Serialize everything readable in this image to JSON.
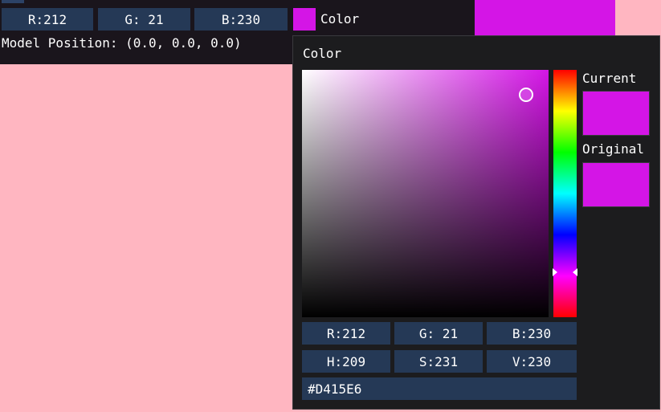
{
  "main_window": {
    "rgb_fields": {
      "r": "R:212",
      "g": "G: 21",
      "b": "B:230"
    },
    "swatch_color": "#D415E6",
    "color_label": "Color",
    "model_position": "Model Position: (0.0, 0.0, 0.0)"
  },
  "picker": {
    "title": "Color",
    "current_label": "Current",
    "original_label": "Original",
    "current_color": "#D415E6",
    "original_color": "#D415E6",
    "rgb_fields": {
      "r": "R:212",
      "g": "G: 21",
      "b": "B:230"
    },
    "hsv_fields": {
      "h": "H:209",
      "s": "S:231",
      "v": "V:230"
    },
    "hex_value": "#D415E6"
  },
  "colors": {
    "background": "#FFB6C1",
    "field_bg": "#253956",
    "window_bg": "#1A151C",
    "popup_bg": "#1C1C1E",
    "accent": "#D415E6"
  },
  "icons": {
    "sv_cursor": "circle-cursor-icon",
    "hue_marker": "triangle-arrow-icon"
  }
}
